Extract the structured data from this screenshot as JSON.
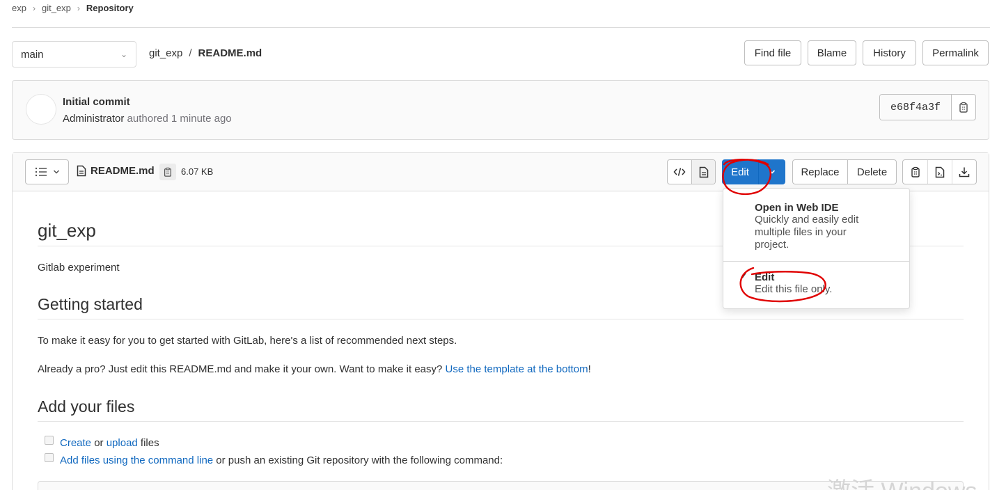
{
  "breadcrumb": {
    "group": "exp",
    "project": "git_exp",
    "current": "Repository"
  },
  "branch": {
    "selected": "main"
  },
  "path": {
    "project": "git_exp",
    "file": "README.md"
  },
  "header_actions": {
    "find_file": "Find file",
    "blame": "Blame",
    "history": "History",
    "permalink": "Permalink"
  },
  "commit": {
    "title": "Initial commit",
    "author": "Administrator",
    "authored_text": "authored 1 minute ago",
    "sha": "e68f4a3f"
  },
  "file": {
    "name": "README.md",
    "size": "6.07 KB"
  },
  "file_actions": {
    "edit": "Edit",
    "replace": "Replace",
    "delete": "Delete"
  },
  "dropdown": {
    "items": [
      {
        "title": "Open in Web IDE",
        "description_lines": [
          "Quickly and easily edit",
          "multiple files in your",
          "project."
        ],
        "checked": false
      },
      {
        "title": "Edit",
        "description_lines": [
          "Edit this file only."
        ],
        "checked": true
      }
    ]
  },
  "readme": {
    "h1": "git_exp",
    "intro": "Gitlab experiment",
    "h2_getting_started": "Getting started",
    "p1": "To make it easy for you to get started with GitLab, here's a list of recommended next steps.",
    "p2_before": "Already a pro? Just edit this README.md and make it your own. Want to make it easy? ",
    "p2_link": "Use the template at the bottom",
    "p2_after": "!",
    "h2_add_files": "Add your files",
    "task1_link1": "Create",
    "task1_mid": " or ",
    "task1_link2": "upload",
    "task1_after": " files",
    "task2_link": "Add files using the command line",
    "task2_after": " or push an existing Git repository with the following command:"
  },
  "watermark": "激活 Windows",
  "icons": [
    "chevron-right-icon",
    "chevron-down-icon",
    "list-icon",
    "file-icon",
    "copy-icon",
    "code-icon",
    "file-text-icon",
    "download-icon",
    "file-raw-icon",
    "check-icon"
  ],
  "colors": {
    "primary": "#1f75cb",
    "link": "#1068bf",
    "annotation": "#e00000"
  }
}
